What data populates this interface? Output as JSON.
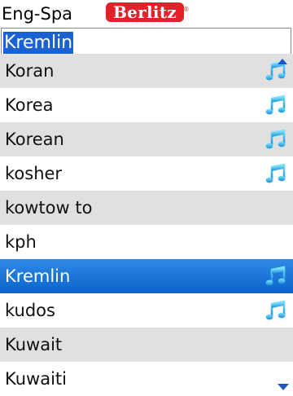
{
  "header": {
    "title": "Eng-Spa",
    "brand": "Berlitz",
    "brand_mark": "®",
    "brand_color": "#e4202a"
  },
  "search": {
    "value": "Kremlin",
    "highlight_color": "#1a62d4"
  },
  "list": {
    "items": [
      {
        "label": "Koran",
        "audio": true,
        "selected": false
      },
      {
        "label": "Korea",
        "audio": true,
        "selected": false
      },
      {
        "label": "Korean",
        "audio": true,
        "selected": false
      },
      {
        "label": "kosher",
        "audio": true,
        "selected": false
      },
      {
        "label": "kowtow to",
        "audio": false,
        "selected": false
      },
      {
        "label": "kph",
        "audio": false,
        "selected": false
      },
      {
        "label": "Kremlin",
        "audio": true,
        "selected": true
      },
      {
        "label": "kudos",
        "audio": true,
        "selected": false
      },
      {
        "label": "Kuwait",
        "audio": false,
        "selected": false
      },
      {
        "label": "Kuwaiti",
        "audio": false,
        "selected": false
      }
    ],
    "audio_icon": "music-note-icon",
    "selection_color": "#0b63c9"
  },
  "scroll": {
    "up_icon": "scroll-up-arrow-icon",
    "down_icon": "scroll-down-arrow-icon"
  }
}
